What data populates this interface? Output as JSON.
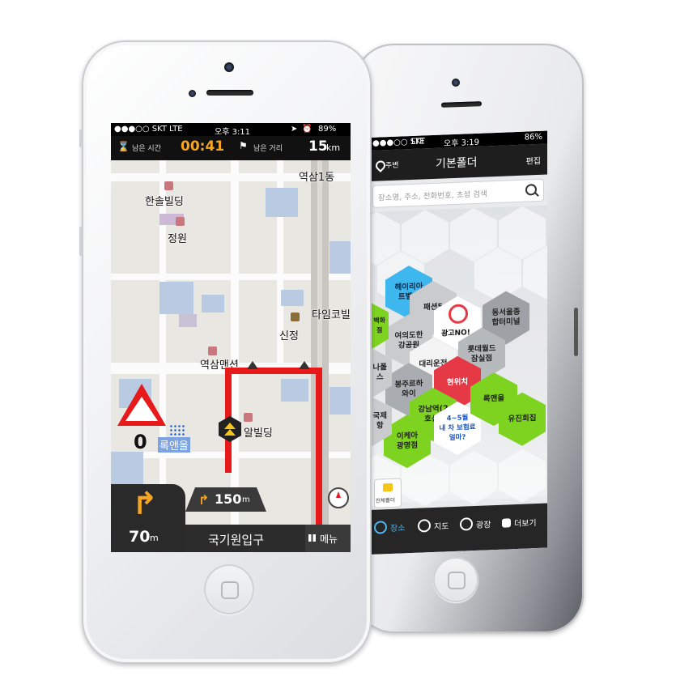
{
  "nav_phone": {
    "status": {
      "carrier": "●●●○○ SKT",
      "network": "LTE",
      "time": "오후 3:11",
      "battery": "89%"
    },
    "topbar": {
      "remaining_time_label": "남은 시간",
      "remaining_time": "00:41",
      "remaining_distance_label": "남은 거리",
      "remaining_distance": "15",
      "remaining_distance_unit": "km"
    },
    "map_labels": {
      "area": "역삼1동",
      "bldg1": "한솔빌딩",
      "bldg2": "정원",
      "bldg3": "타임코빌",
      "bldg4": "신정",
      "bldg5": "역삼맨션",
      "bldg6": "알빌딩",
      "bldg7": "록앤올"
    },
    "camera_warning": {
      "speed_value": "0"
    },
    "next_turn": {
      "distance": "150",
      "unit": "m"
    },
    "bottom": {
      "turn_distance": "70",
      "turn_unit": "m",
      "road_name": "국기원입구",
      "menu_label": "메뉴"
    }
  },
  "place_phone": {
    "status": {
      "carrier": "●●●○○ SKT",
      "network": "LTE",
      "time": "오후 3:19",
      "battery": "86%"
    },
    "header": {
      "nearby_label": "주변",
      "title": "기본폴더",
      "edit_label": "편집"
    },
    "search": {
      "placeholder": "장소명, 주소, 전화번호, 초성 검색"
    },
    "hexes": {
      "h1": "헤이리아\n트벨리",
      "h2": "패션5",
      "h3": "광고NO!",
      "h4": "동서울종\n합터미널",
      "h5": "여의도한\n강공원",
      "h6": "대리운전",
      "h7": "롯데월드\n잠실점",
      "h8": "봉주르하\n와이",
      "h9": "현위치",
      "h10": "강남역(2\n호선)",
      "h11": "4~5월\n내 차 보험료\n얼마?",
      "h12": "록앤올",
      "h13": "이케아\n광명점",
      "h14": "유진회집",
      "h15": "나폴\n스",
      "h16": "국제\n항",
      "h17": "백화\n점"
    },
    "folder_label": "전체폴더",
    "tabs": {
      "places": "장소",
      "map": "지도",
      "plaza": "광장",
      "more": "더보기"
    }
  },
  "colors": {
    "accent_orange": "#f5a623",
    "route_red": "#e8191b",
    "hex_green": "#7ed321",
    "hex_blue": "#37b3ef",
    "hex_red": "#e63946"
  }
}
